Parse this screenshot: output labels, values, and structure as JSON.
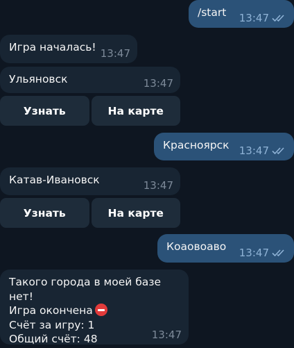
{
  "messages": [
    {
      "text": "/start",
      "time": "13:47"
    },
    {
      "text": "Игра началась!",
      "time": "13:47"
    },
    {
      "text": "Ульяновск",
      "time": "13:47"
    },
    {
      "text": "Красноярск",
      "time": "13:47"
    },
    {
      "text": "Катав-Ивановск",
      "time": "13:47"
    },
    {
      "text": "Коаовоаво",
      "time": "13:47"
    },
    {
      "lines": [
        "Такого города в моей базе нет!",
        "Игра окончена",
        "Счёт за игру: 1",
        "Общий счёт: 48"
      ],
      "time": "13:47"
    }
  ],
  "keyboards": [
    {
      "buttons": [
        "Узнать",
        "На карте"
      ]
    },
    {
      "buttons": [
        "Узнать",
        "На карте"
      ]
    }
  ],
  "icons": {
    "read_receipt": "double-check-icon",
    "game_over": "no-entry-icon"
  },
  "colors": {
    "background": "#0e1621",
    "incoming": "#182533",
    "outgoing": "#2b5278",
    "button": "#1e2c3a"
  }
}
